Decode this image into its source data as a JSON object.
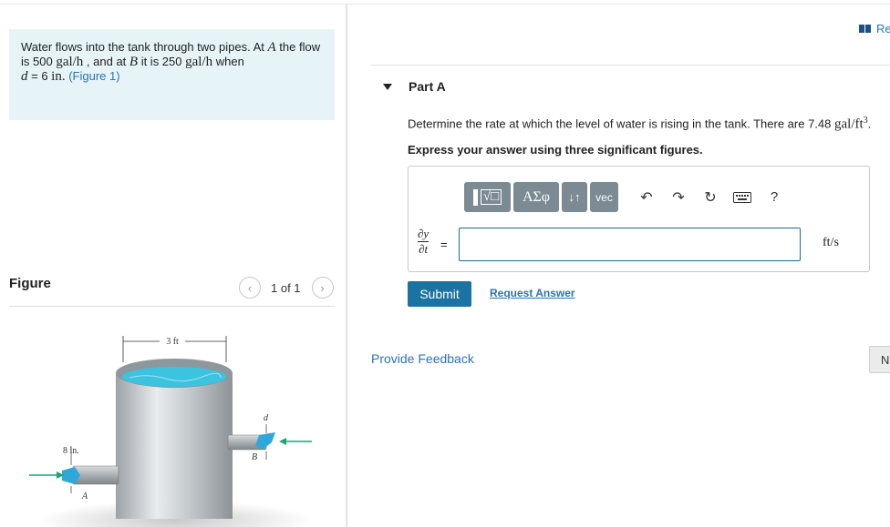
{
  "problem": {
    "text_1": "Water flows into the tank through two pipes. At ",
    "point_a": "A",
    "text_2": " the flow is 500 ",
    "unit_a": "gal/h",
    "text_3": " , and at ",
    "point_b": "B",
    "text_4": " it is 250 ",
    "unit_b": "gal/h",
    "text_5": " when",
    "var_d": "d",
    "text_6": " = 6 ",
    "unit_in": "in.",
    "figure_link": "(Figure 1)"
  },
  "figure": {
    "label": "Figure",
    "pager": "1 of 1",
    "prev_icon": "chevron-left-icon",
    "next_icon": "chevron-right-icon",
    "dim_width": "3 ft",
    "dim_pipe": "8 in.",
    "label_a": "A",
    "label_b": "B",
    "label_d": "d"
  },
  "review": {
    "label": "Re",
    "icon": "book-icon"
  },
  "part": {
    "title": "Part A",
    "question": "Determine the rate at which the level of water is rising in the tank. There are 7.48 ",
    "question_unit": "gal/ft",
    "question_exp": "3",
    "question_end": ".",
    "instruction": "Express your answer using three significant figures."
  },
  "toolbar": {
    "greek": "ΑΣφ",
    "arrows": "↓↑",
    "vec": "vec",
    "icons": [
      "templates-icon",
      "greek-icon",
      "subscript-icon",
      "vec-icon",
      "undo-icon",
      "redo-icon",
      "reset-icon",
      "keyboard-icon",
      "help-icon"
    ],
    "help": "?"
  },
  "answer": {
    "deriv_num": "∂y",
    "deriv_den": "∂t",
    "equals": "=",
    "value": "",
    "unit": "ft/s"
  },
  "actions": {
    "submit": "Submit",
    "request": "Request Answer",
    "feedback": "Provide Feedback",
    "next": "N"
  },
  "colors": {
    "panel_bg": "#e6f4f8",
    "link": "#2b73b9",
    "submit_bg": "#1a73a0",
    "toolbar_bg": "#7b8a93",
    "water": "#3cc3e0",
    "arrow": "#1aa37a"
  }
}
